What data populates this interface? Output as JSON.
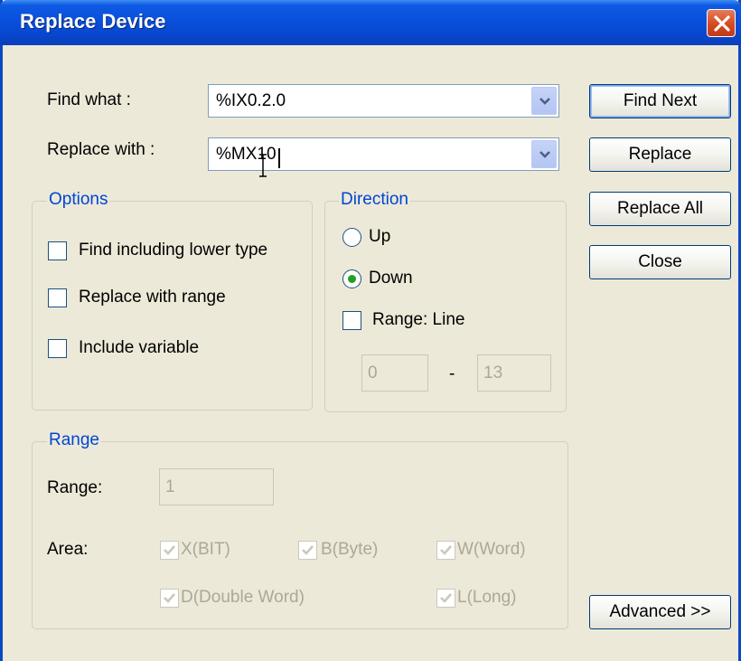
{
  "window": {
    "title": "Replace Device"
  },
  "find": {
    "label": "Find what :",
    "value": "%IX0.2.0"
  },
  "replace": {
    "label": "Replace with :",
    "value": "%MX10"
  },
  "buttons": {
    "find_next": "Find Next",
    "replace": "Replace",
    "replace_all": "Replace All",
    "close": "Close",
    "advanced": "Advanced >>"
  },
  "options": {
    "title": "Options",
    "find_including_lower_type": "Find including lower type",
    "replace_with_range": "Replace with range",
    "include_variable": "Include variable"
  },
  "direction": {
    "title": "Direction",
    "up": "Up",
    "down": "Down",
    "selected": "Down",
    "range_line": "Range: Line",
    "line_from": "0",
    "separator": "-",
    "line_to": "13"
  },
  "range": {
    "title": "Range",
    "range_label": "Range:",
    "range_value": "1",
    "area_label": "Area:",
    "areas": [
      "X(BIT)",
      "B(Byte)",
      "W(Word)",
      "D(Double Word)",
      "L(Long)"
    ]
  }
}
